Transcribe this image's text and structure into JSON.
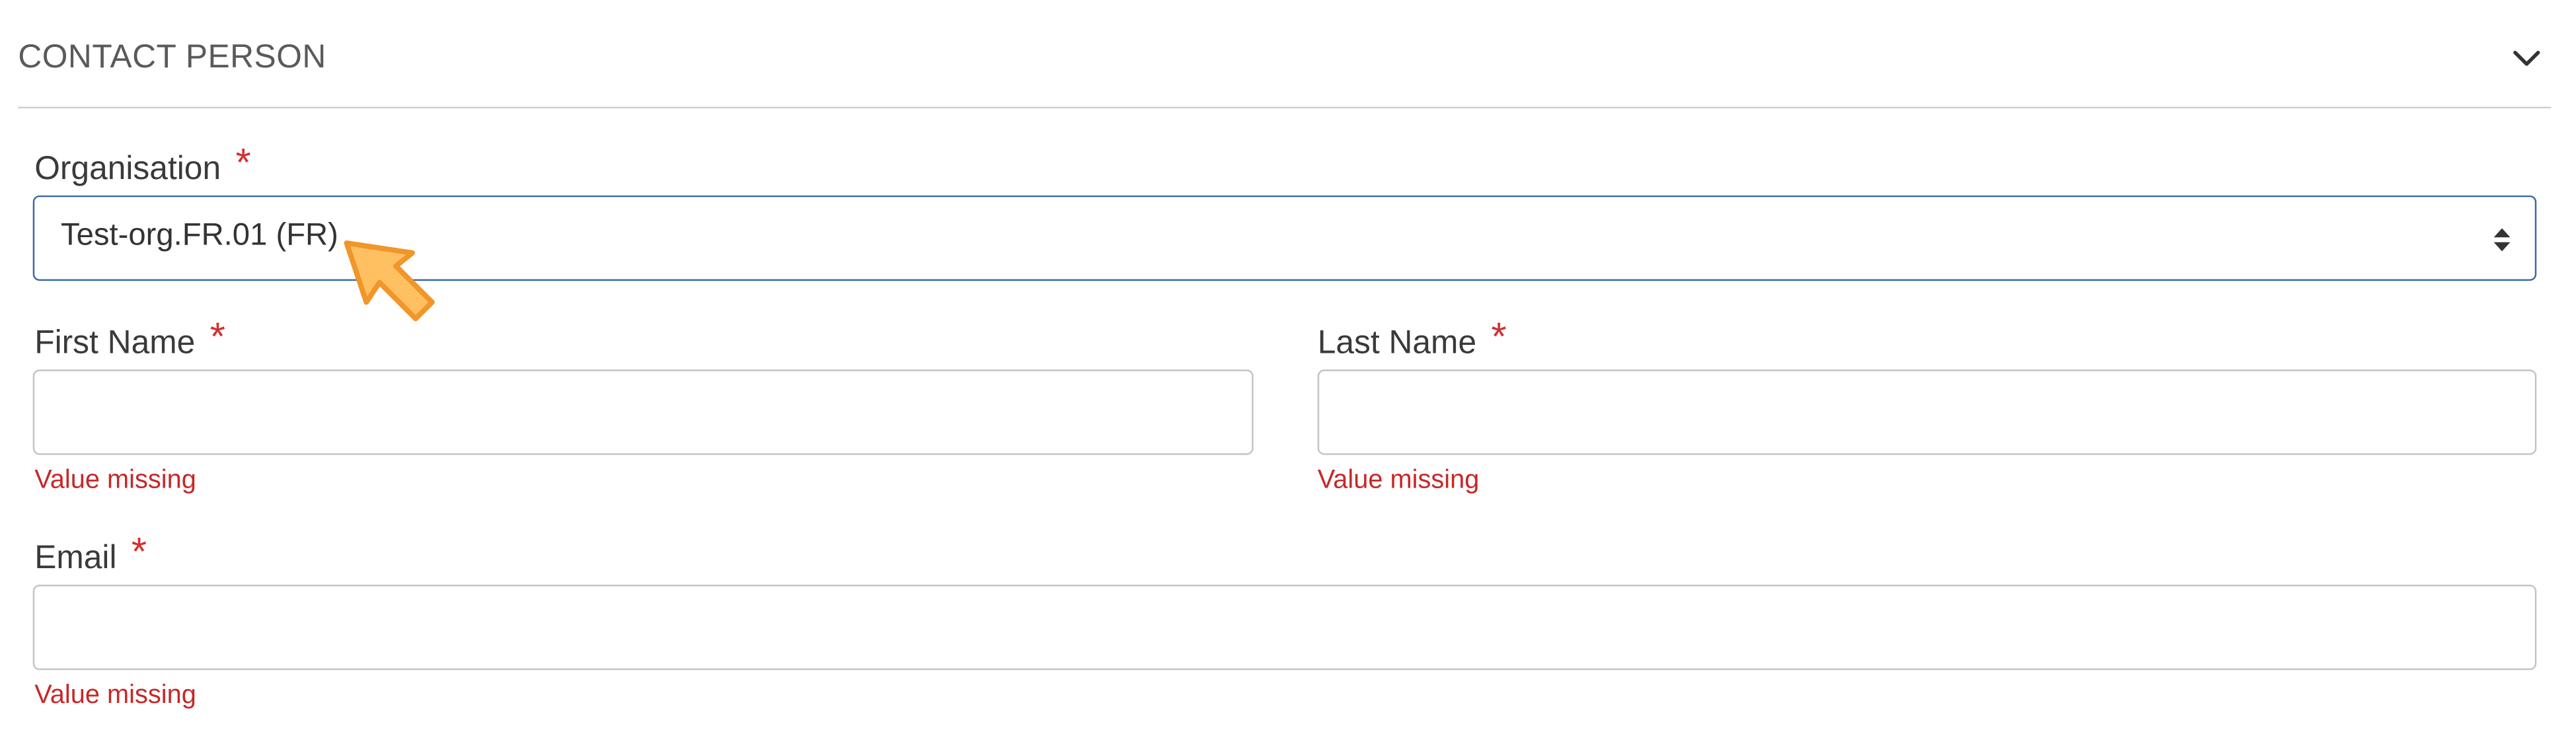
{
  "section": {
    "title": "CONTACT PERSON",
    "toggle_icon": "chevron-down-icon"
  },
  "organisation": {
    "label": "Organisation",
    "required_mark": "*",
    "selected": "Test-org.FR.01 (FR)",
    "focused": true
  },
  "first_name": {
    "label": "First Name",
    "required_mark": "*",
    "value": "",
    "error": "Value missing"
  },
  "last_name": {
    "label": "Last Name",
    "required_mark": "*",
    "value": "",
    "error": "Value missing"
  },
  "email": {
    "label": "Email",
    "required_mark": "*",
    "value": "",
    "error": "Value missing"
  },
  "colors": {
    "required": "#d32f2f",
    "error": "#c62828",
    "focus_border": "#3b6aa3",
    "cursor_fill": "#ffc061",
    "cursor_stroke": "#f0962a"
  }
}
